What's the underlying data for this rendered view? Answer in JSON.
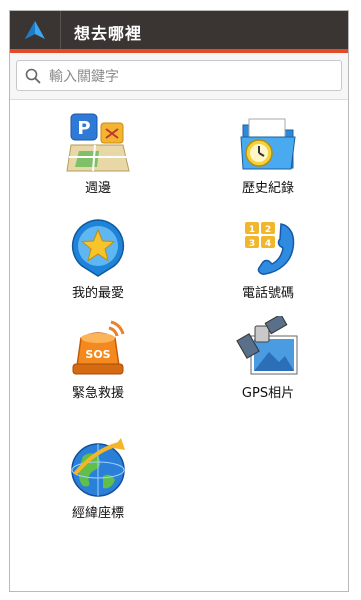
{
  "header": {
    "title": "想去哪裡"
  },
  "search": {
    "placeholder": "輸入關鍵字",
    "value": ""
  },
  "menu": {
    "items": [
      {
        "label": "週邊"
      },
      {
        "label": "歷史紀錄"
      },
      {
        "label": "我的最愛"
      },
      {
        "label": "電話號碼"
      },
      {
        "label": "緊急救援"
      },
      {
        "label": "GPS相片"
      },
      {
        "label": "經緯座標"
      }
    ]
  },
  "icon_glyphs": {
    "parking": "P",
    "phone_keys": [
      "1",
      "2",
      "3",
      "4"
    ],
    "sos": "SOS"
  },
  "colors": {
    "titlebar": "#3a3532",
    "accent": "#e24b26"
  }
}
